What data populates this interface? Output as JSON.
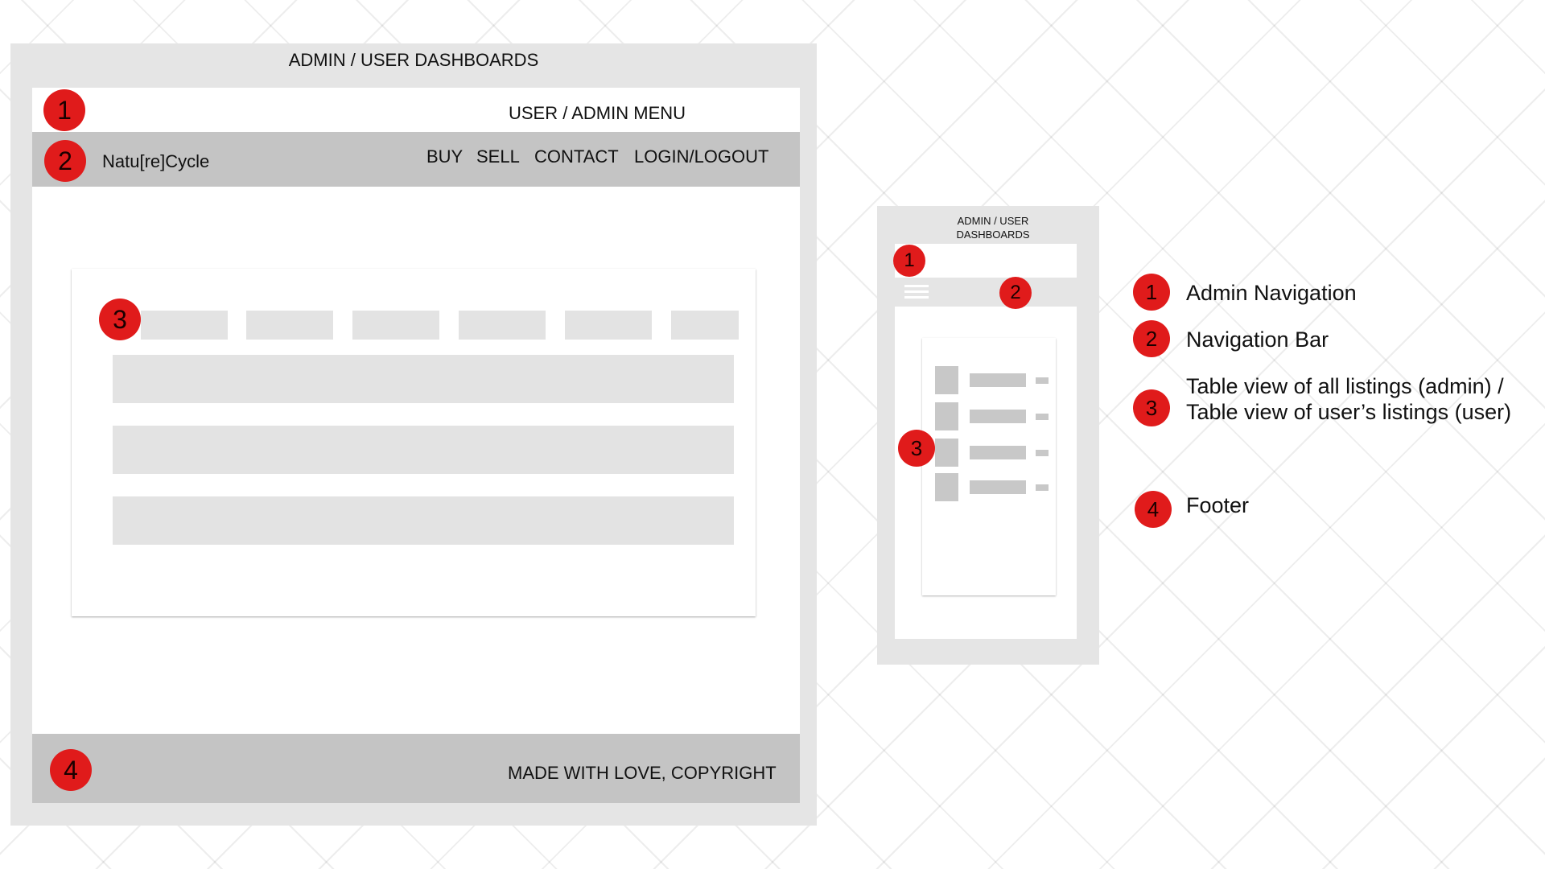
{
  "desktop": {
    "title": "ADMIN / USER DASHBOARDS",
    "menu_label": "USER / ADMIN MENU",
    "brand": "Natu[re]Cycle",
    "nav_links": [
      "BUY",
      "SELL",
      "CONTACT",
      "LOGIN/LOGOUT"
    ],
    "footer_text": "MADE WITH LOVE, COPYRIGHT",
    "markers": [
      "1",
      "2",
      "3",
      "4"
    ]
  },
  "mobile": {
    "title": "ADMIN / USER DASHBOARDS",
    "markers": [
      "1",
      "2",
      "3"
    ],
    "list_row_count": 4
  },
  "legend": [
    {
      "number": "1",
      "text": "Admin Navigation"
    },
    {
      "number": "2",
      "text": "Navigation Bar"
    },
    {
      "number": "3",
      "text": "Table view of all listings (admin) / Table view of user’s listings (user)"
    },
    {
      "number": "4",
      "text": "Footer"
    }
  ],
  "colors": {
    "marker": "#e01b1b",
    "frame": "#e5e5e5",
    "nav_bar": "#c4c4c4",
    "placeholder": "#e3e3e3"
  }
}
